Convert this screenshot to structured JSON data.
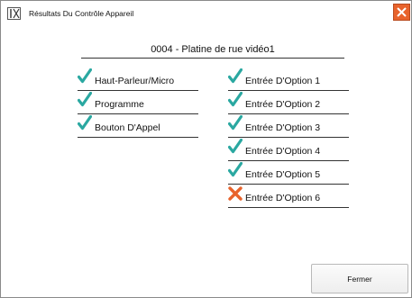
{
  "window": {
    "title": "Résultats Du Contrôle Appareil",
    "app_icon": "ix-logo-icon",
    "close_icon": "close-icon"
  },
  "heading": "0004 - Platine de rue vidéo1",
  "colors": {
    "pass": "#2aa8a1",
    "fail": "#e8632c",
    "close_button": "#e8632c"
  },
  "results": {
    "left": [
      {
        "label": "Haut-Parleur/Micro",
        "status": "pass",
        "icon": "check-icon"
      },
      {
        "label": "Programme",
        "status": "pass",
        "icon": "check-icon"
      },
      {
        "label": "Bouton D'Appel",
        "status": "pass",
        "icon": "check-icon"
      }
    ],
    "right": [
      {
        "label": "Entrée D'Option 1",
        "status": "pass",
        "icon": "check-icon"
      },
      {
        "label": "Entrée D'Option 2",
        "status": "pass",
        "icon": "check-icon"
      },
      {
        "label": "Entrée D'Option 3",
        "status": "pass",
        "icon": "check-icon"
      },
      {
        "label": "Entrée D'Option 4",
        "status": "pass",
        "icon": "check-icon"
      },
      {
        "label": "Entrée D'Option 5",
        "status": "pass",
        "icon": "check-icon"
      },
      {
        "label": "Entrée D'Option 6",
        "status": "fail",
        "icon": "cross-icon"
      }
    ]
  },
  "buttons": {
    "close_label": "Fermer"
  }
}
